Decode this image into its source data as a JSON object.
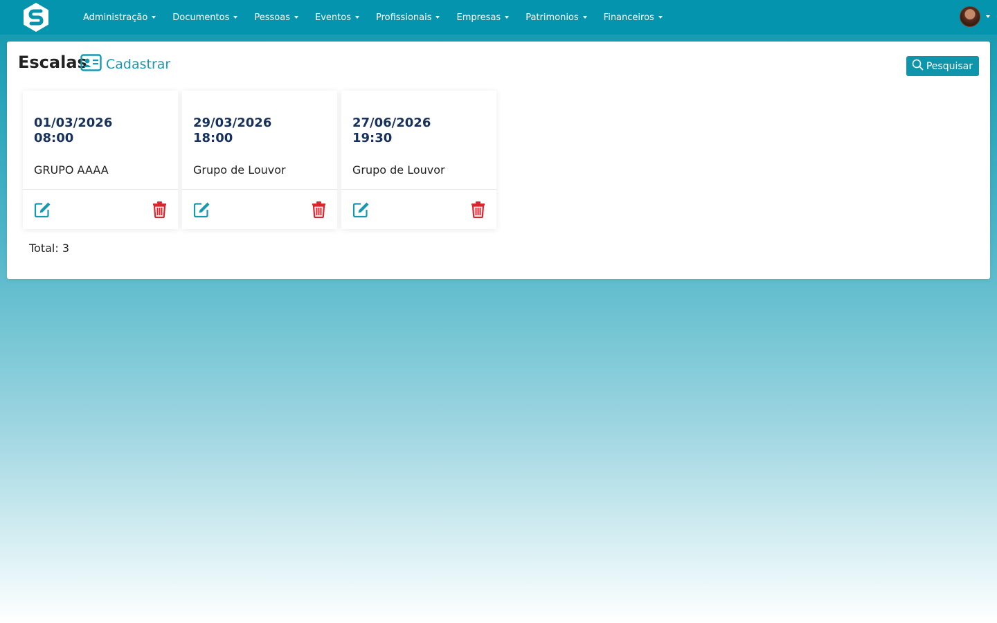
{
  "navbar": {
    "menu": [
      {
        "label": "Administração"
      },
      {
        "label": "Documentos"
      },
      {
        "label": "Pessoas"
      },
      {
        "label": "Eventos"
      },
      {
        "label": "Profissionais"
      },
      {
        "label": "Empresas"
      },
      {
        "label": "Patrimonios"
      },
      {
        "label": "Financeiros"
      }
    ],
    "icons": {
      "logo": "s-logo-icon",
      "user": "avatar",
      "dropdown": "caret-down-icon"
    }
  },
  "page": {
    "title": "Escalas",
    "create_label": "Cadastrar",
    "create_icon": "id-card-icon",
    "search_label": "Pesquisar",
    "search_icon": "search-icon"
  },
  "cards": [
    {
      "date": "01/03/2026",
      "time": "08:00",
      "group": "GRUPO AAAA"
    },
    {
      "date": "29/03/2026",
      "time": "18:00",
      "group": "Grupo de Louvor"
    },
    {
      "date": "27/06/2026",
      "time": "19:30",
      "group": "Grupo de Louvor"
    }
  ],
  "card_actions": {
    "edit_icon": "edit-icon",
    "delete_icon": "trash-icon"
  },
  "footer": {
    "total": "Total: 3"
  },
  "colors": {
    "primary": "#0594ad",
    "accent": "#1699b0",
    "date_text": "#16325c",
    "danger": "#d9252c"
  }
}
